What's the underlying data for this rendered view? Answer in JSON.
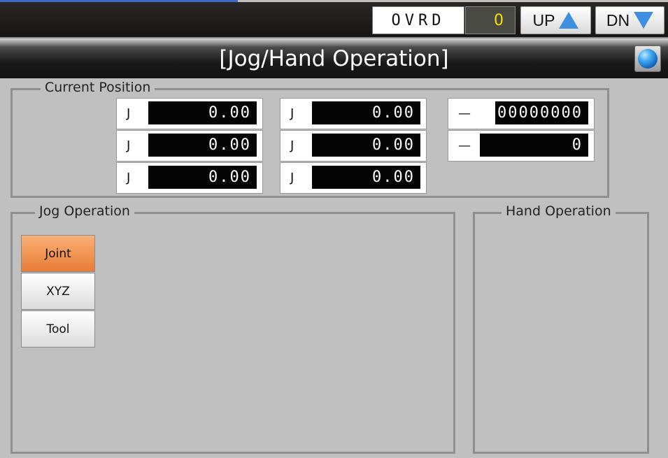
{
  "header": {
    "ovrd_label": "OVRD",
    "ovrd_value": "0",
    "up_label": "UP",
    "dn_label": "DN"
  },
  "title": "[Jog/Hand Operation]",
  "current_position": {
    "label": "Current Position",
    "joints": [
      {
        "label": "J",
        "value": "0.00"
      },
      {
        "label": "J",
        "value": "0.00"
      },
      {
        "label": "J",
        "value": "0.00"
      },
      {
        "label": "J",
        "value": "0.00"
      },
      {
        "label": "J",
        "value": "0.00"
      },
      {
        "label": "J",
        "value": "0.00"
      }
    ],
    "extra": [
      {
        "label": "—",
        "value": "00000000"
      },
      {
        "label": "—",
        "value": "0"
      }
    ]
  },
  "jog_operation": {
    "label": "Jog Operation",
    "modes": [
      "Joint",
      "XYZ",
      "Tool"
    ],
    "selected": "Joint"
  },
  "hand_operation": {
    "label": "Hand Operation"
  },
  "colors": {
    "active_mode": "#e87d36",
    "ovrd_value_text": "#f2e100",
    "arrow_blue": "#3f8fe0"
  },
  "icons": [
    "globe-icon",
    "arrow-up-icon",
    "arrow-down-icon"
  ]
}
